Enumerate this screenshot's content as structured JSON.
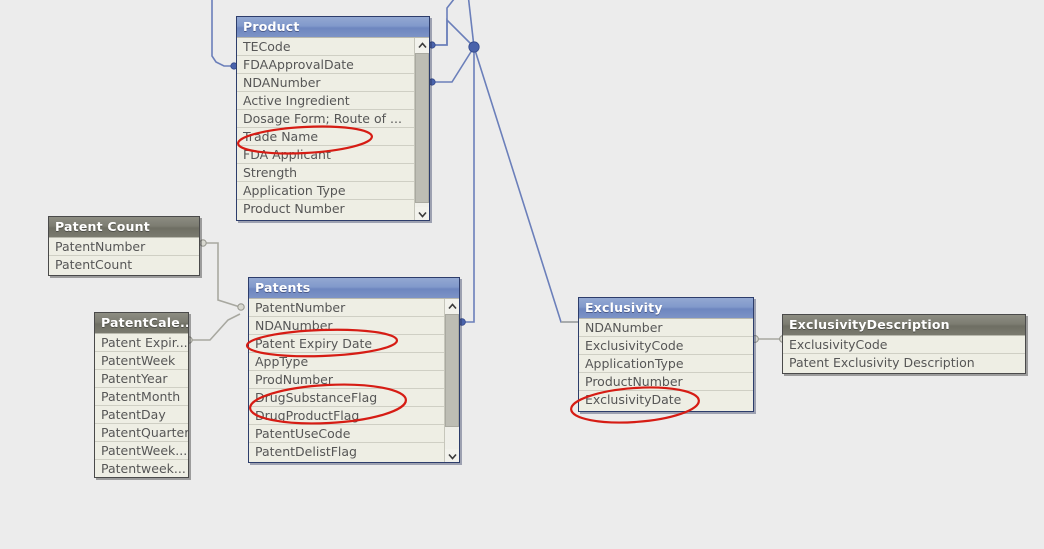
{
  "canvas": {
    "background": "#ececec",
    "accent_active": "#7d93c6",
    "accent_inactive": "#7c7c71",
    "annotation_color": "#d61c14",
    "link_active_color": "#6b7fba",
    "link_inactive_color": "#a8a8a0"
  },
  "entities": [
    {
      "id": "product",
      "name": "Product",
      "title": "Product",
      "state": "active",
      "scrollable": true,
      "scroll_up_icon": "chevron-up-icon",
      "scroll_down_icon": "chevron-down-icon",
      "fields": [
        "TECode",
        "FDAApprovalDate",
        "NDANumber",
        "Active Ingredient",
        "Dosage Form; Route of ...",
        "Trade Name",
        "FDA Applicant",
        "Strength",
        "Application Type",
        "Product Number"
      ]
    },
    {
      "id": "patent-count",
      "name": "Patent Count",
      "title": "Patent Count",
      "state": "inactive",
      "scrollable": false,
      "fields": [
        "PatentNumber",
        "PatentCount"
      ]
    },
    {
      "id": "patent-calendar",
      "name": "PatentCalendar",
      "title": "PatentCale...",
      "state": "inactive",
      "scrollable": false,
      "fields": [
        "Patent Expir...",
        "PatentWeek",
        "PatentYear",
        "PatentMonth",
        "PatentDay",
        "PatentQuarter",
        "PatentWeek...",
        "Patentweek..."
      ]
    },
    {
      "id": "patents",
      "name": "Patents",
      "title": "Patents",
      "state": "active",
      "scrollable": true,
      "scroll_up_icon": "chevron-up-icon",
      "scroll_down_icon": "chevron-down-icon",
      "fields": [
        "PatentNumber",
        "NDANumber",
        "Patent Expiry Date",
        "AppType",
        "ProdNumber",
        "DrugSubstanceFlag",
        "DrugProductFlag",
        "PatentUseCode",
        "PatentDelistFlag"
      ]
    },
    {
      "id": "exclusivity",
      "name": "Exclusivity",
      "title": "Exclusivity",
      "state": "active",
      "scrollable": false,
      "fields": [
        "NDANumber",
        "ExclusivityCode",
        "ApplicationType",
        "ProductNumber",
        "ExclusivityDate"
      ]
    },
    {
      "id": "exclusivity-description",
      "name": "ExclusivityDescription",
      "title": "ExclusivityDescription",
      "state": "inactive",
      "scrollable": false,
      "fields": [
        "ExclusivityCode",
        "Patent Exclusivity Description"
      ]
    }
  ],
  "annotations": [
    {
      "id": "annot-trade-name",
      "target": "Trade Name"
    },
    {
      "id": "annot-patent-expiry-date",
      "target": "Patent Expiry Date"
    },
    {
      "id": "annot-drug-flags",
      "target": "DrugSubstanceFlag / DrugProductFlag"
    },
    {
      "id": "annot-exclusivity-date",
      "target": "ExclusivityDate"
    }
  ]
}
